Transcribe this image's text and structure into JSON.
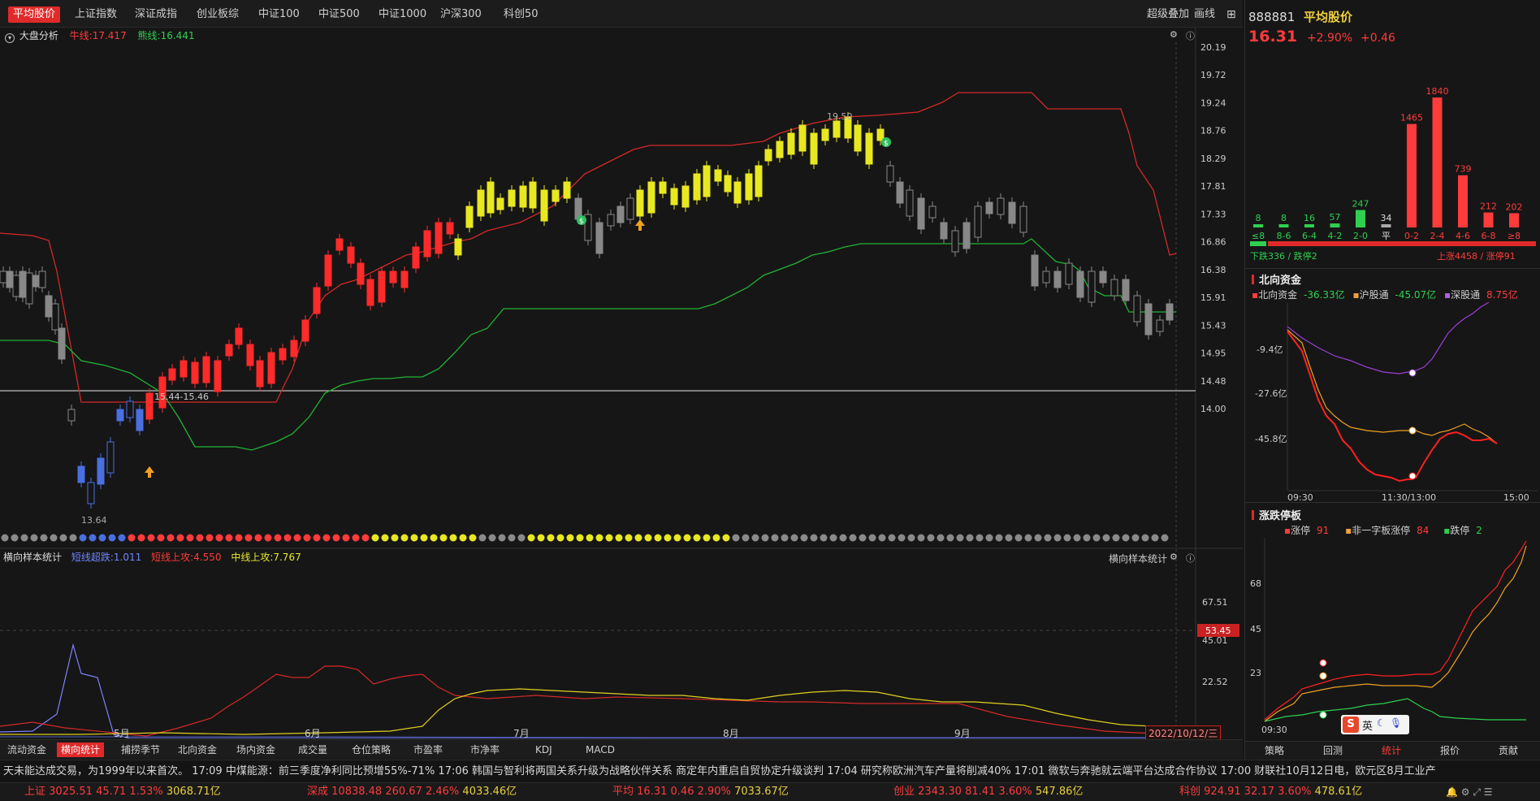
{
  "topnav": {
    "tabs": [
      "平均股价",
      "上证指数",
      "深证成指",
      "创业板综",
      "中证100",
      "中证500",
      "中证1000",
      "沪深300",
      "科创50"
    ],
    "active": 0,
    "right": [
      "超级叠加",
      "画线"
    ]
  },
  "main_indicator": {
    "name": "大盘分析",
    "mid": "牛线:17.417",
    "bear": "熊线:16.441"
  },
  "main_axis": [
    "20.19",
    "19.72",
    "19.24",
    "18.76",
    "18.29",
    "17.81",
    "17.33",
    "16.86",
    "16.38",
    "15.91",
    "15.43",
    "14.95",
    "14.48",
    "14.00"
  ],
  "annotations": {
    "high": "19.50",
    "low": "13.64",
    "range": "15.44-15.46"
  },
  "sub_indicator": {
    "name": "横向样本统计",
    "name_right": "横向样本统计",
    "s1": "短线超跌:1.011",
    "s2": "短线上攻:4.550",
    "s3": "中线上攻:7.767"
  },
  "sub_axis": [
    "67.51",
    "45.01",
    "22.52"
  ],
  "sub_marker": "53.45",
  "months": [
    "5月",
    "6月",
    "7月",
    "8月",
    "9月"
  ],
  "date_label": "2022/10/12/三",
  "bottom_tabs": [
    "流动资金",
    "横向统计",
    "捕捞季节",
    "北向资金",
    "场内资金",
    "成交量",
    "仓位策略",
    "市盈率",
    "市净率",
    "KDJ",
    "MACD"
  ],
  "bottom_active": 1,
  "quote": {
    "code": "888881",
    "name": "平均股价",
    "price": "16.31",
    "pct": "+2.90%",
    "chg": "+0.46"
  },
  "distribution": {
    "labels": [
      "≤8",
      "8-6",
      "6-4",
      "4-2",
      "2-0",
      "平",
      "0-2",
      "2-4",
      "4-6",
      "6-8",
      "≥8"
    ],
    "values": [
      8,
      8,
      16,
      57,
      247,
      34,
      1465,
      1840,
      739,
      212,
      202
    ],
    "down": "下跌336 / 跌停2",
    "up": "上涨4458 / 涨停91"
  },
  "north": {
    "title": "北向资金",
    "l1": "北向资金",
    "v1": "-36.33亿",
    "l2": "沪股通",
    "v2": "-45.07亿",
    "l3": "深股通",
    "v3": "8.75亿",
    "axis": [
      "-9.4亿",
      "-27.6亿",
      "-45.8亿"
    ],
    "times": [
      "09:30",
      "11:30/13:00",
      "15:00"
    ]
  },
  "limit": {
    "title": "涨跌停板",
    "l1": "涨停",
    "v1": "91",
    "l2": "非一字板涨停",
    "v2": "84",
    "l3": "跌停",
    "v3": "2",
    "axis": [
      "68",
      "45",
      "23"
    ],
    "time": "09:30"
  },
  "right_tabs": [
    "策略",
    "回测",
    "统计",
    "报价",
    "贡献"
  ],
  "right_active": 2,
  "ime": {
    "logo": "S",
    "lang": "英"
  },
  "news": "天未能达成交易，为1999年以来首次。    17:09 中煤能源：前三季度净利同比预增55%-71%     17:06 韩国与智利将两国关系升级为战略伙伴关系 商定年内重启自贸协定升级谈判     17:04 研究称欧洲汽车产量将削减40%     17:01 微软与奔驰就云端平台达成合作协议     17:00 财联社10月12日电，欧元区8月工业产",
  "indices": [
    {
      "name": "上证",
      "v": "3025.51",
      "c": "45.71",
      "p": "1.53%",
      "amt": "3068.71亿"
    },
    {
      "name": "深成",
      "v": "10838.48",
      "c": "260.67",
      "p": "2.46%",
      "amt": "4033.46亿"
    },
    {
      "name": "平均",
      "v": "16.31",
      "c": "0.46",
      "p": "2.90%",
      "amt": "7033.67亿"
    },
    {
      "name": "创业",
      "v": "2343.30",
      "c": "81.41",
      "p": "3.60%",
      "amt": "547.86亿"
    },
    {
      "name": "科创",
      "v": "924.91",
      "c": "32.17",
      "p": "3.60%",
      "amt": "478.61亿"
    }
  ],
  "colors": {
    "up": "#ff3b3b",
    "down": "#2fcf4f",
    "accent": "#e02a2a",
    "yellow": "#e8e830",
    "blue": "#4a6fe0"
  }
}
